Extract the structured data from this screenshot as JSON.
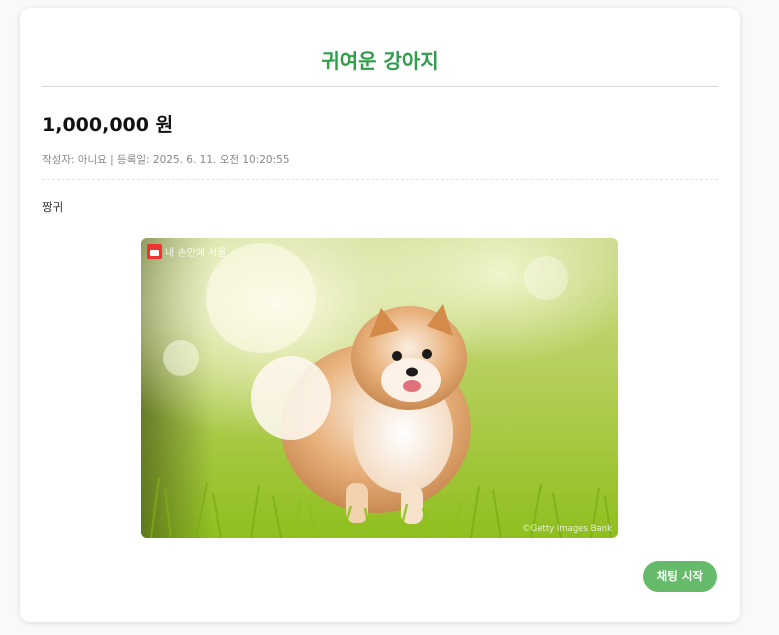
{
  "post": {
    "title": "귀여운 강아지",
    "price": "1,000,000 원",
    "meta": "작성자: 아니요 | 등록일: 2025. 6. 11. 오전 10:20:55",
    "content": "짱귀",
    "image": {
      "watermark": "내 손안에 서울",
      "credit": "©Getty Images Bank"
    }
  },
  "actions": {
    "chat_label": "채팅 시작"
  },
  "colors": {
    "title": "#2e9e4b",
    "chat_button": "#66bb6a"
  }
}
